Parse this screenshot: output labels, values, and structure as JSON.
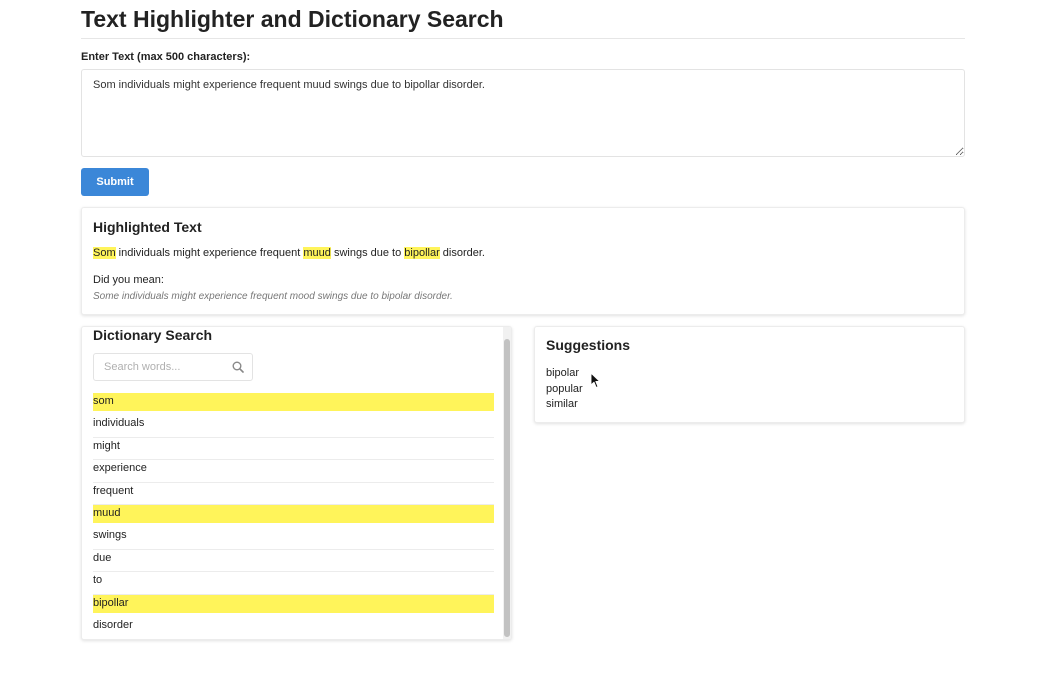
{
  "page": {
    "title": "Text Highlighter and Dictionary Search"
  },
  "input": {
    "label": "Enter Text (max 500 characters):",
    "value": "Som individuals might experience frequent muud swings due to bipollar disorder."
  },
  "submit": {
    "label": "Submit"
  },
  "highlighted": {
    "heading": "Highlighted Text",
    "segments": [
      {
        "text": "Som",
        "highlighted": true
      },
      {
        "text": " individuals might experience frequent ",
        "highlighted": false
      },
      {
        "text": "muud",
        "highlighted": true
      },
      {
        "text": " swings due to ",
        "highlighted": false
      },
      {
        "text": "bipollar",
        "highlighted": true
      },
      {
        "text": " disorder.",
        "highlighted": false
      }
    ],
    "did_you_mean_label": "Did you mean:",
    "corrected": "Some individuals might experience frequent mood swings due to bipolar disorder."
  },
  "dictionary": {
    "heading": "Dictionary Search",
    "search_placeholder": "Search words...",
    "words": [
      {
        "word": "som",
        "highlighted": true
      },
      {
        "word": "individuals",
        "highlighted": false
      },
      {
        "word": "might",
        "highlighted": false
      },
      {
        "word": "experience",
        "highlighted": false
      },
      {
        "word": "frequent",
        "highlighted": false
      },
      {
        "word": "muud",
        "highlighted": true
      },
      {
        "word": "swings",
        "highlighted": false
      },
      {
        "word": "due",
        "highlighted": false
      },
      {
        "word": "to",
        "highlighted": false
      },
      {
        "word": "bipollar",
        "highlighted": true
      },
      {
        "word": "disorder",
        "highlighted": false
      }
    ]
  },
  "suggestions": {
    "heading": "Suggestions",
    "items": [
      "bipolar",
      "popular",
      "similar"
    ]
  },
  "colors": {
    "accent": "#3b87d8",
    "highlight": "#fff45a"
  },
  "icons": {
    "search": "search-icon",
    "cursor": "mouse-pointer-icon"
  }
}
